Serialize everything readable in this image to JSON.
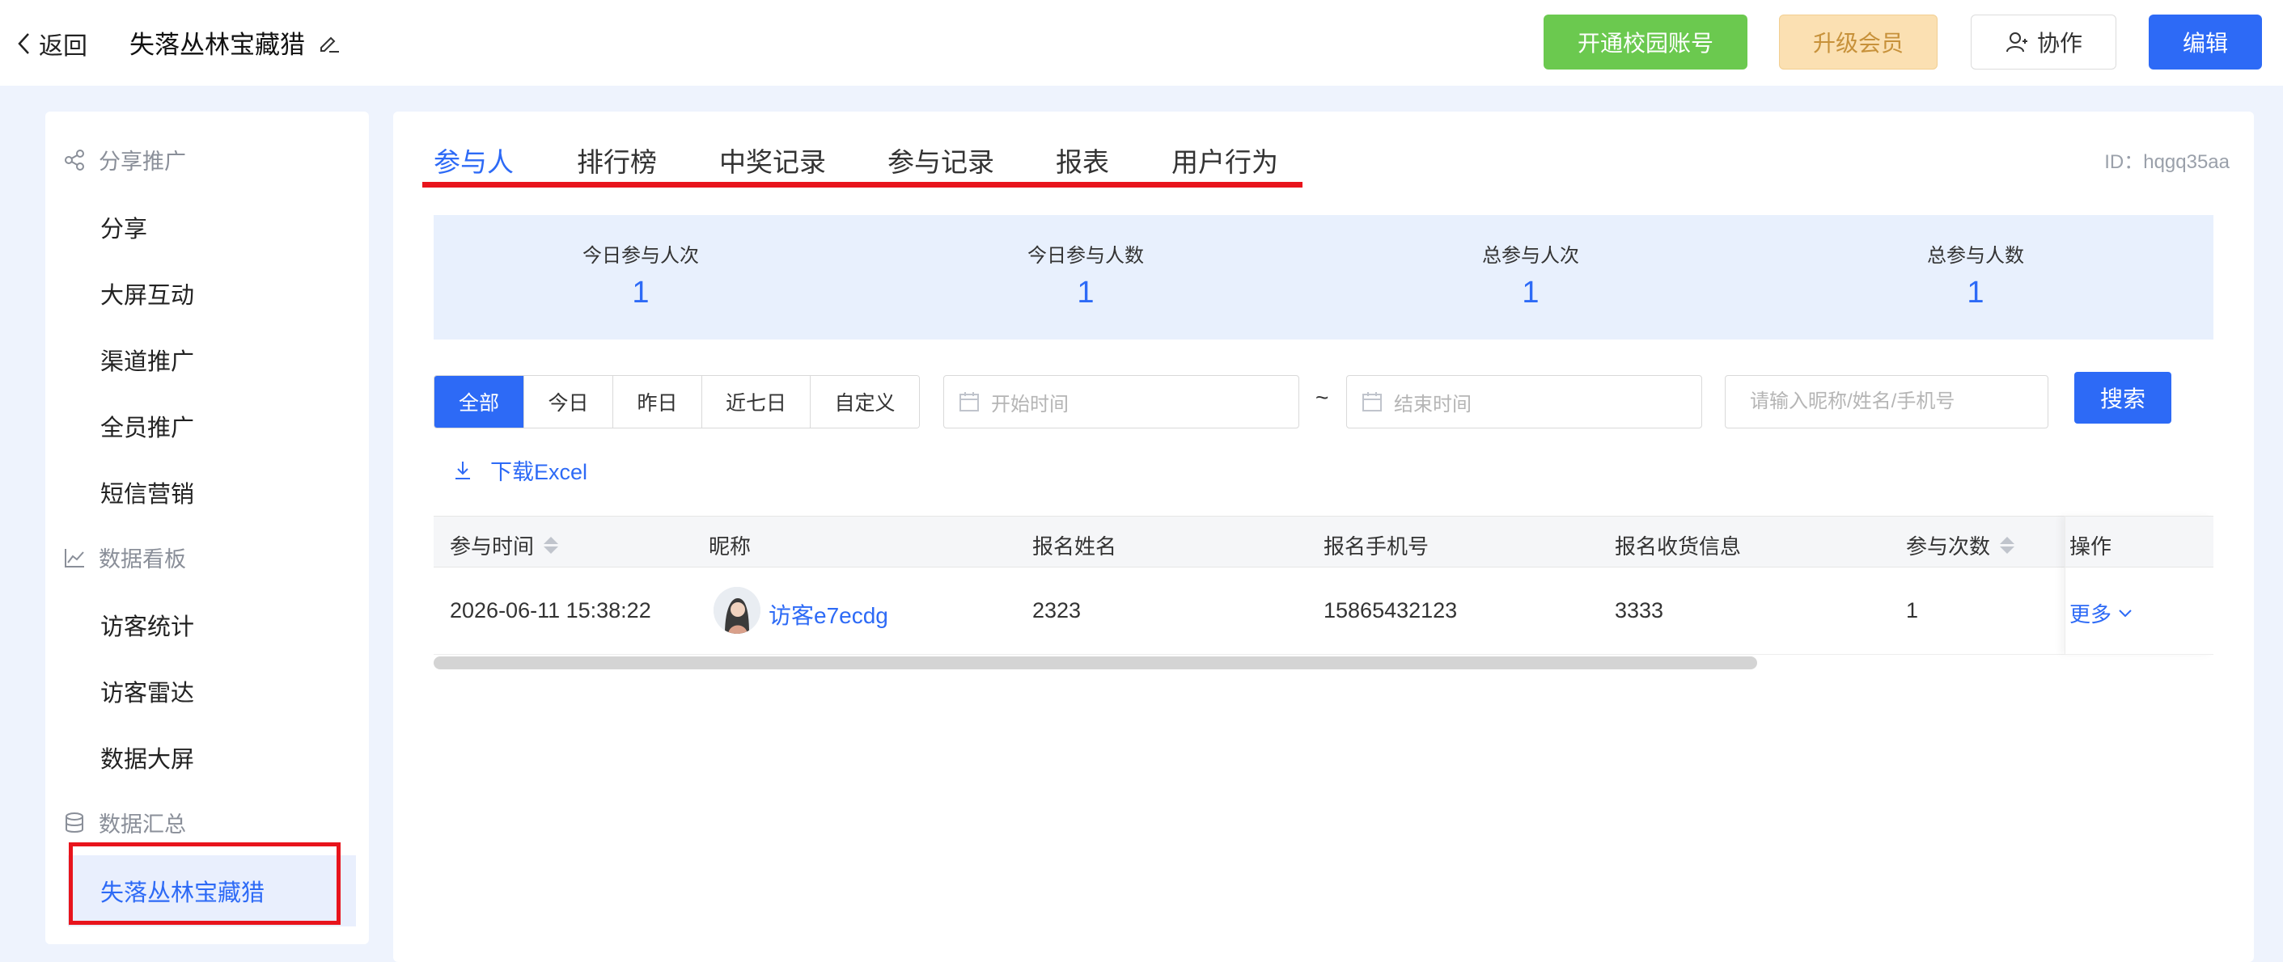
{
  "header": {
    "back_label": "返回",
    "title": "失落丛林宝藏猎",
    "btn_campus": "开通校园账号",
    "btn_vip": "升级会员",
    "btn_collab": "协作",
    "btn_edit": "编辑"
  },
  "sidebar": {
    "group_share": "分享推广",
    "share_items": [
      "分享",
      "大屏互动",
      "渠道推广",
      "全员推广",
      "短信营销"
    ],
    "group_data": "数据看板",
    "data_items": [
      "访客统计",
      "访客雷达",
      "数据大屏"
    ],
    "group_summary": "数据汇总",
    "active_item": "失落丛林宝藏猎"
  },
  "tabs": [
    "参与人",
    "排行榜",
    "中奖记录",
    "参与记录",
    "报表",
    "用户行为"
  ],
  "id_text": "ID：hqgq35aa",
  "stats": [
    {
      "label": "今日参与人次",
      "value": "1"
    },
    {
      "label": "今日参与人数",
      "value": "1"
    },
    {
      "label": "总参与人次",
      "value": "1"
    },
    {
      "label": "总参与人数",
      "value": "1"
    }
  ],
  "filters": {
    "segments": [
      "全部",
      "今日",
      "昨日",
      "近七日",
      "自定义"
    ],
    "start_placeholder": "开始时间",
    "tilde": "~",
    "end_placeholder": "结束时间",
    "search_placeholder": "请输入昵称/姓名/手机号",
    "search_button": "搜索"
  },
  "download_label": "下载Excel",
  "table": {
    "headers": [
      "参与时间",
      "昵称",
      "报名姓名",
      "报名手机号",
      "报名收货信息",
      "参与次数",
      "操作"
    ],
    "row": {
      "time": "2026-06-11 15:38:22",
      "nickname": "访客e7ecdg",
      "name": "2323",
      "phone": "15865432123",
      "address": "3333",
      "count": "1",
      "action": "更多"
    }
  },
  "colors": {
    "accent": "#2d6af6",
    "green": "#6bc94f",
    "vip_bg": "#fbe0b2",
    "highlight": "#e8141c"
  }
}
